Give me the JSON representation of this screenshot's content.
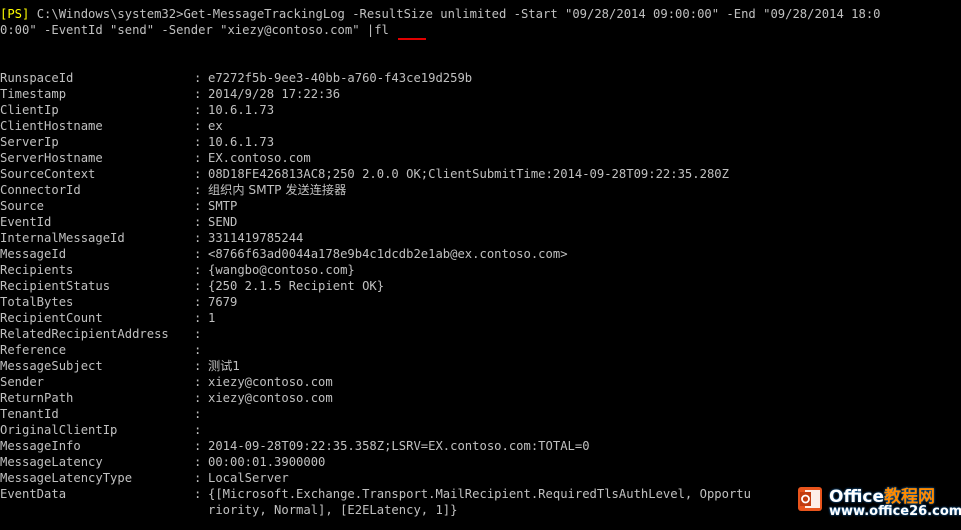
{
  "command": {
    "prompt_tag": "[PS]",
    "line1": " C:\\Windows\\system32>Get-MessageTrackingLog -ResultSize unlimited -Start \"09/28/2014 09:00:00\" -End \"09/28/2014 18:0",
    "line2_before": "0:00\" -EventId \"send\" -Sender \"xiezy@contoso.com\" ",
    "line2_pipe": "|fl"
  },
  "records": [
    {
      "key": "RunspaceId",
      "value": "e7272f5b-9ee3-40bb-a760-f43ce19d259b"
    },
    {
      "key": "Timestamp",
      "value": "2014/9/28 17:22:36"
    },
    {
      "key": "ClientIp",
      "value": "10.6.1.73"
    },
    {
      "key": "ClientHostname",
      "value": "ex"
    },
    {
      "key": "ServerIp",
      "value": "10.6.1.73"
    },
    {
      "key": "ServerHostname",
      "value": "EX.contoso.com"
    },
    {
      "key": "SourceContext",
      "value": "08D18FE426813AC8;250 2.0.0 OK;ClientSubmitTime:2014-09-28T09:22:35.280Z"
    },
    {
      "key": "ConnectorId",
      "value": "组织内 SMTP 发送连接器"
    },
    {
      "key": "Source",
      "value": "SMTP"
    },
    {
      "key": "EventId",
      "value": "SEND"
    },
    {
      "key": "InternalMessageId",
      "value": "3311419785244"
    },
    {
      "key": "MessageId",
      "value": "<8766f63ad0044a178e9b4c1dcdb2e1ab@ex.contoso.com>"
    },
    {
      "key": "Recipients",
      "value": "{wangbo@contoso.com}"
    },
    {
      "key": "RecipientStatus",
      "value": "{250 2.1.5 Recipient OK}"
    },
    {
      "key": "TotalBytes",
      "value": "7679"
    },
    {
      "key": "RecipientCount",
      "value": "1"
    },
    {
      "key": "RelatedRecipientAddress",
      "value": ""
    },
    {
      "key": "Reference",
      "value": ""
    },
    {
      "key": "MessageSubject",
      "value": "测试1"
    },
    {
      "key": "Sender",
      "value": "xiezy@contoso.com"
    },
    {
      "key": "ReturnPath",
      "value": "xiezy@contoso.com"
    },
    {
      "key": "TenantId",
      "value": ""
    },
    {
      "key": "OriginalClientIp",
      "value": ""
    },
    {
      "key": "MessageInfo",
      "value": "2014-09-28T09:22:35.358Z;LSRV=EX.contoso.com:TOTAL=0"
    },
    {
      "key": "MessageLatency",
      "value": "00:00:01.3900000"
    },
    {
      "key": "MessageLatencyType",
      "value": "LocalServer"
    },
    {
      "key": "EventData",
      "value": "{[Microsoft.Exchange.Transport.MailRecipient.RequiredTlsAuthLevel, Opportu"
    }
  ],
  "event_data_continuation": "riority, Normal], [E2ELatency, 1]}",
  "separator": ":",
  "watermark": {
    "title_main": "Office",
    "title_accent": "教程网",
    "url": "www.office26.com"
  },
  "colors": {
    "background": "#000000",
    "text": "#c0c0c0",
    "prompt_tag": "#ffff00",
    "underline": "#e00000"
  }
}
